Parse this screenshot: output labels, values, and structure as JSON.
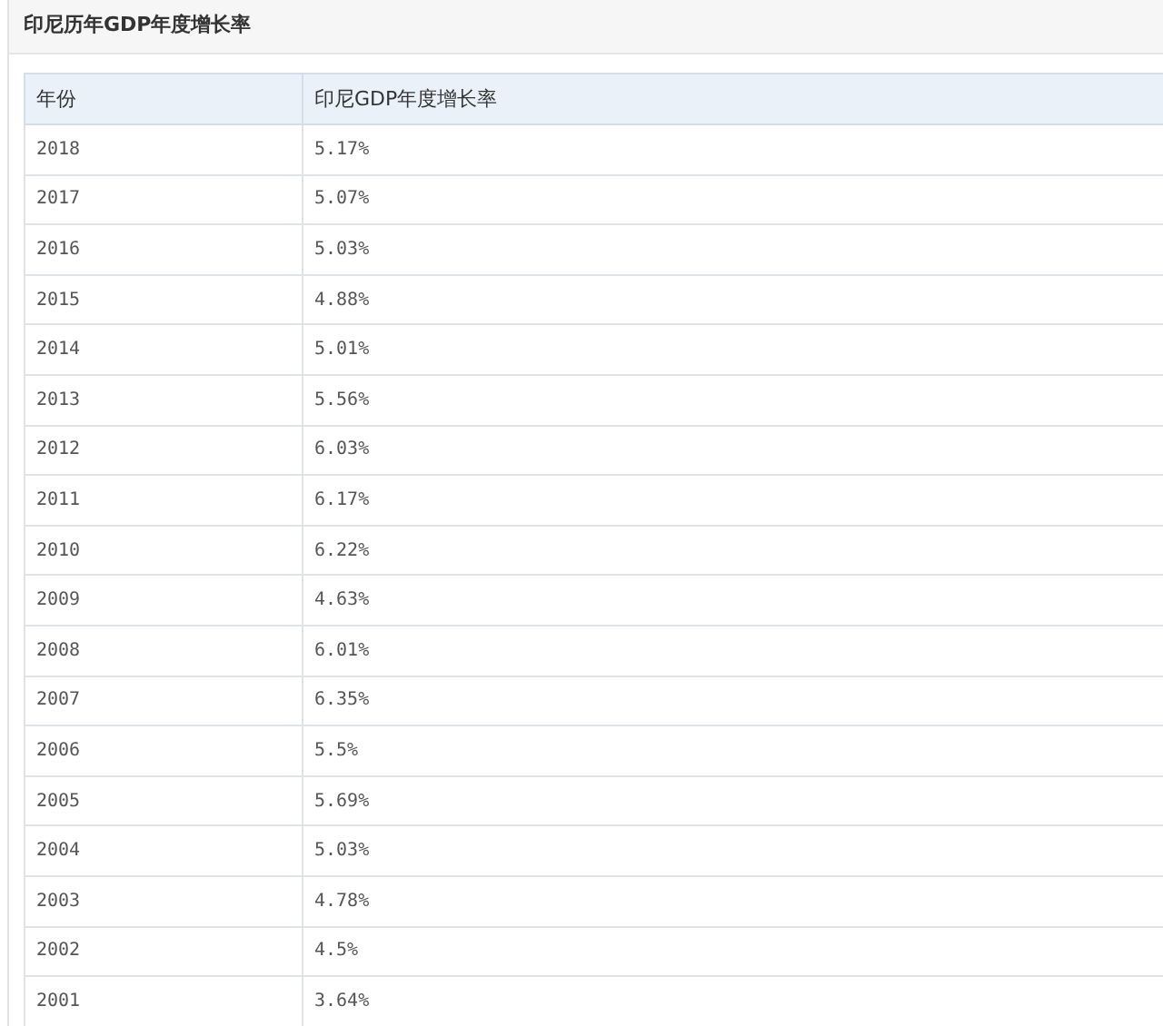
{
  "title": "印尼历年GDP年度增长率",
  "table": {
    "columns": [
      "年份",
      "印尼GDP年度增长率"
    ],
    "rows": [
      [
        "2018",
        "5.17%"
      ],
      [
        "2017",
        "5.07%"
      ],
      [
        "2016",
        "5.03%"
      ],
      [
        "2015",
        "4.88%"
      ],
      [
        "2014",
        "5.01%"
      ],
      [
        "2013",
        "5.56%"
      ],
      [
        "2012",
        "6.03%"
      ],
      [
        "2011",
        "6.17%"
      ],
      [
        "2010",
        "6.22%"
      ],
      [
        "2009",
        "4.63%"
      ],
      [
        "2008",
        "6.01%"
      ],
      [
        "2007",
        "6.35%"
      ],
      [
        "2006",
        "5.5%"
      ],
      [
        "2005",
        "5.69%"
      ],
      [
        "2004",
        "5.03%"
      ],
      [
        "2003",
        "4.78%"
      ],
      [
        "2002",
        "4.5%"
      ],
      [
        "2001",
        "3.64%"
      ]
    ]
  }
}
